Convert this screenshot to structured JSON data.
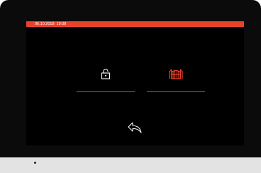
{
  "status_bar": {
    "date": "06.10.2018",
    "time": "19:08",
    "color": "#e8432a"
  },
  "actions": [
    {
      "name": "unlock-door",
      "icon": "padlock-open-icon",
      "active": false
    },
    {
      "name": "open-gate",
      "icon": "gate-icon",
      "active": true
    }
  ],
  "back": {
    "icon": "back-arrow-icon"
  },
  "colors": {
    "accent": "#e8432a",
    "screen": "#000000",
    "icon_inactive": "#ffffff"
  }
}
